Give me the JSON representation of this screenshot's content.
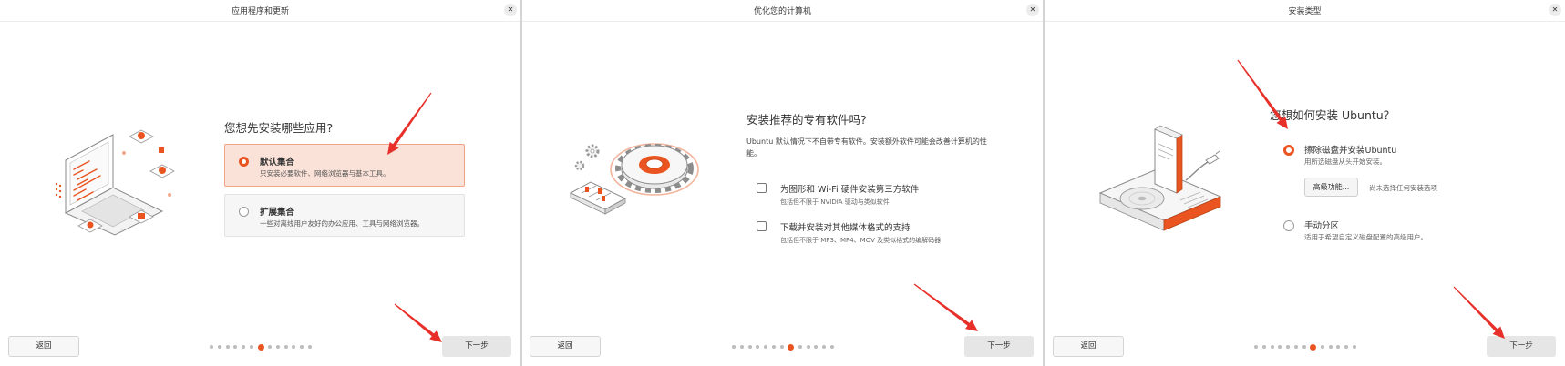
{
  "colors": {
    "accent": "#E95420",
    "arrow": "#E8302A",
    "selected_bg": "#FBE2D8"
  },
  "icons": {
    "close": "✕"
  },
  "panels": [
    {
      "title": "应用程序和更新",
      "heading": "您想先安装哪些应用?",
      "options": [
        {
          "label": "默认集合",
          "description": "只安装必要软件、网络浏览器与基本工具。",
          "selected": true
        },
        {
          "label": "扩展集合",
          "description": "一些对离线用户友好的办公应用、工具与网络浏览器。",
          "selected": false
        }
      ],
      "back_label": "返回",
      "next_label": "下一步",
      "steps": {
        "total": 13,
        "current": 7
      }
    },
    {
      "title": "优化您的计算机",
      "heading": "安装推荐的专有软件吗?",
      "description": "Ubuntu 默认情况下不自带专有软件。安装额外软件可能会改善计算机的性能。",
      "checkboxes": [
        {
          "label": "为图形和 Wi-Fi 硬件安装第三方软件",
          "description": "包括但不限于 NVIDIA 驱动与类似软件",
          "checked": false
        },
        {
          "label": "下载并安装对其他媒体格式的支持",
          "description": "包括但不限于 MP3、MP4、MOV 及类似格式的编解码器",
          "checked": false
        }
      ],
      "back_label": "返回",
      "next_label": "下一步",
      "steps": {
        "total": 13,
        "current": 8
      }
    },
    {
      "title": "安装类型",
      "heading": "您想如何安装 Ubuntu？",
      "options": [
        {
          "label": "擦除磁盘并安装Ubuntu",
          "description": "用所选磁盘从头开始安装。",
          "selected": true
        },
        {
          "label": "手动分区",
          "description": "适用于希望自定义磁盘配置的高级用户。",
          "selected": false
        }
      ],
      "advanced_button": "高级功能...",
      "advanced_status": "尚未选择任何安装选项",
      "back_label": "返回",
      "next_label": "下一步",
      "steps": {
        "total": 13,
        "current": 8
      }
    }
  ]
}
